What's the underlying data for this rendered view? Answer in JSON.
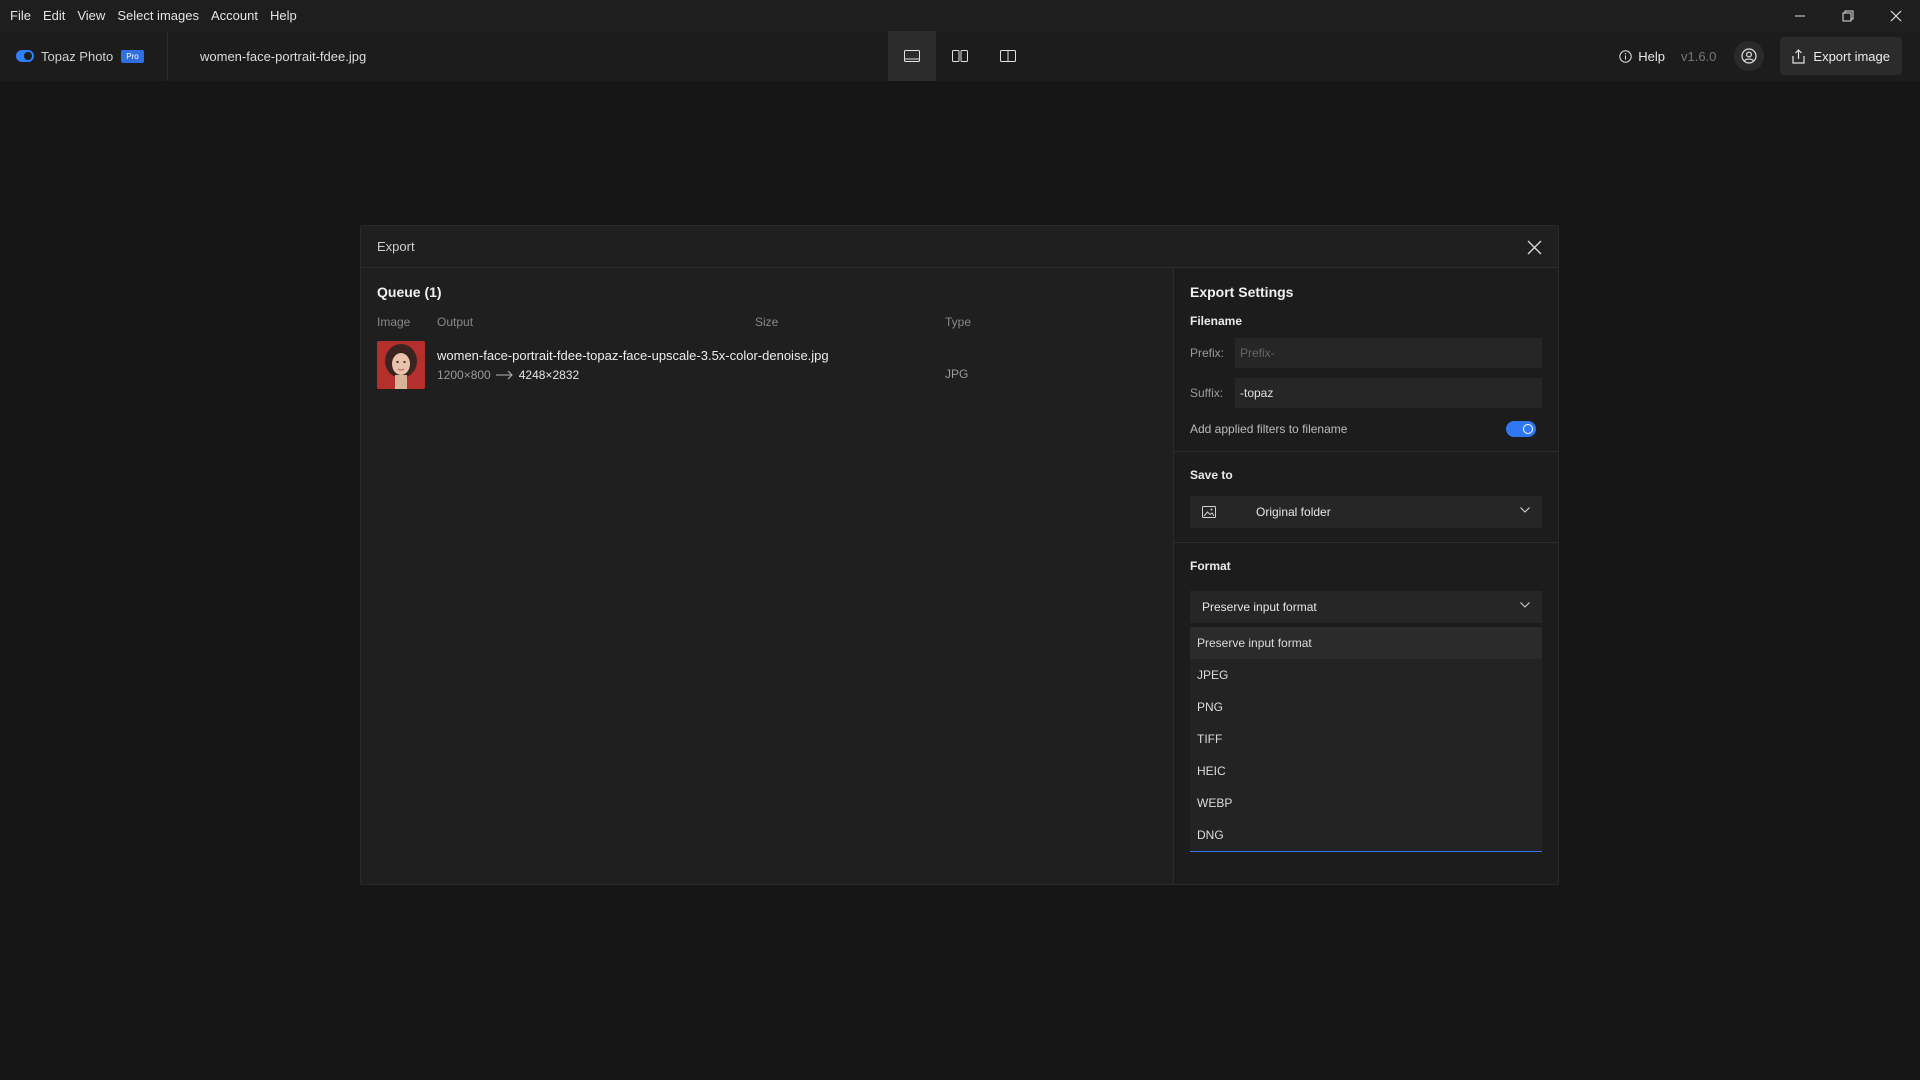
{
  "menu": {
    "items": [
      "File",
      "Edit",
      "View",
      "Select images",
      "Account",
      "Help"
    ]
  },
  "toolbar": {
    "brand": "Topaz Photo",
    "badge": "Pro",
    "filename": "women-face-portrait-fdee.jpg",
    "help_label": "Help",
    "version": "v1.6.0",
    "export_label": "Export image"
  },
  "modal": {
    "title": "Export",
    "queue": {
      "title": "Queue (1)",
      "columns": [
        "Image",
        "Output",
        "Size",
        "Type"
      ],
      "rows": [
        {
          "output_name": "women-face-portrait-fdee-topaz-face-upscale-3.5x-color-denoise.jpg",
          "from_size": "1200×800",
          "to_size": "4248×2832",
          "type": "JPG"
        }
      ]
    },
    "settings": {
      "title": "Export Settings",
      "filename_label": "Filename",
      "prefix_label": "Prefix:",
      "prefix_placeholder": "Prefix-",
      "suffix_label": "Suffix:",
      "suffix_value": "-topaz",
      "filters_toggle_label": "Add applied filters to filename",
      "filters_toggle_on": true,
      "save_to_label": "Save to",
      "save_to_value": "Original folder",
      "format_label": "Format",
      "format_value": "Preserve input format",
      "format_options": [
        "Preserve input format",
        "JPEG",
        "PNG",
        "TIFF",
        "HEIC",
        "WEBP",
        "DNG"
      ]
    }
  },
  "colors": {
    "accent": "#2f78f0",
    "background": "#161616",
    "modal": "#1f1f1f"
  }
}
